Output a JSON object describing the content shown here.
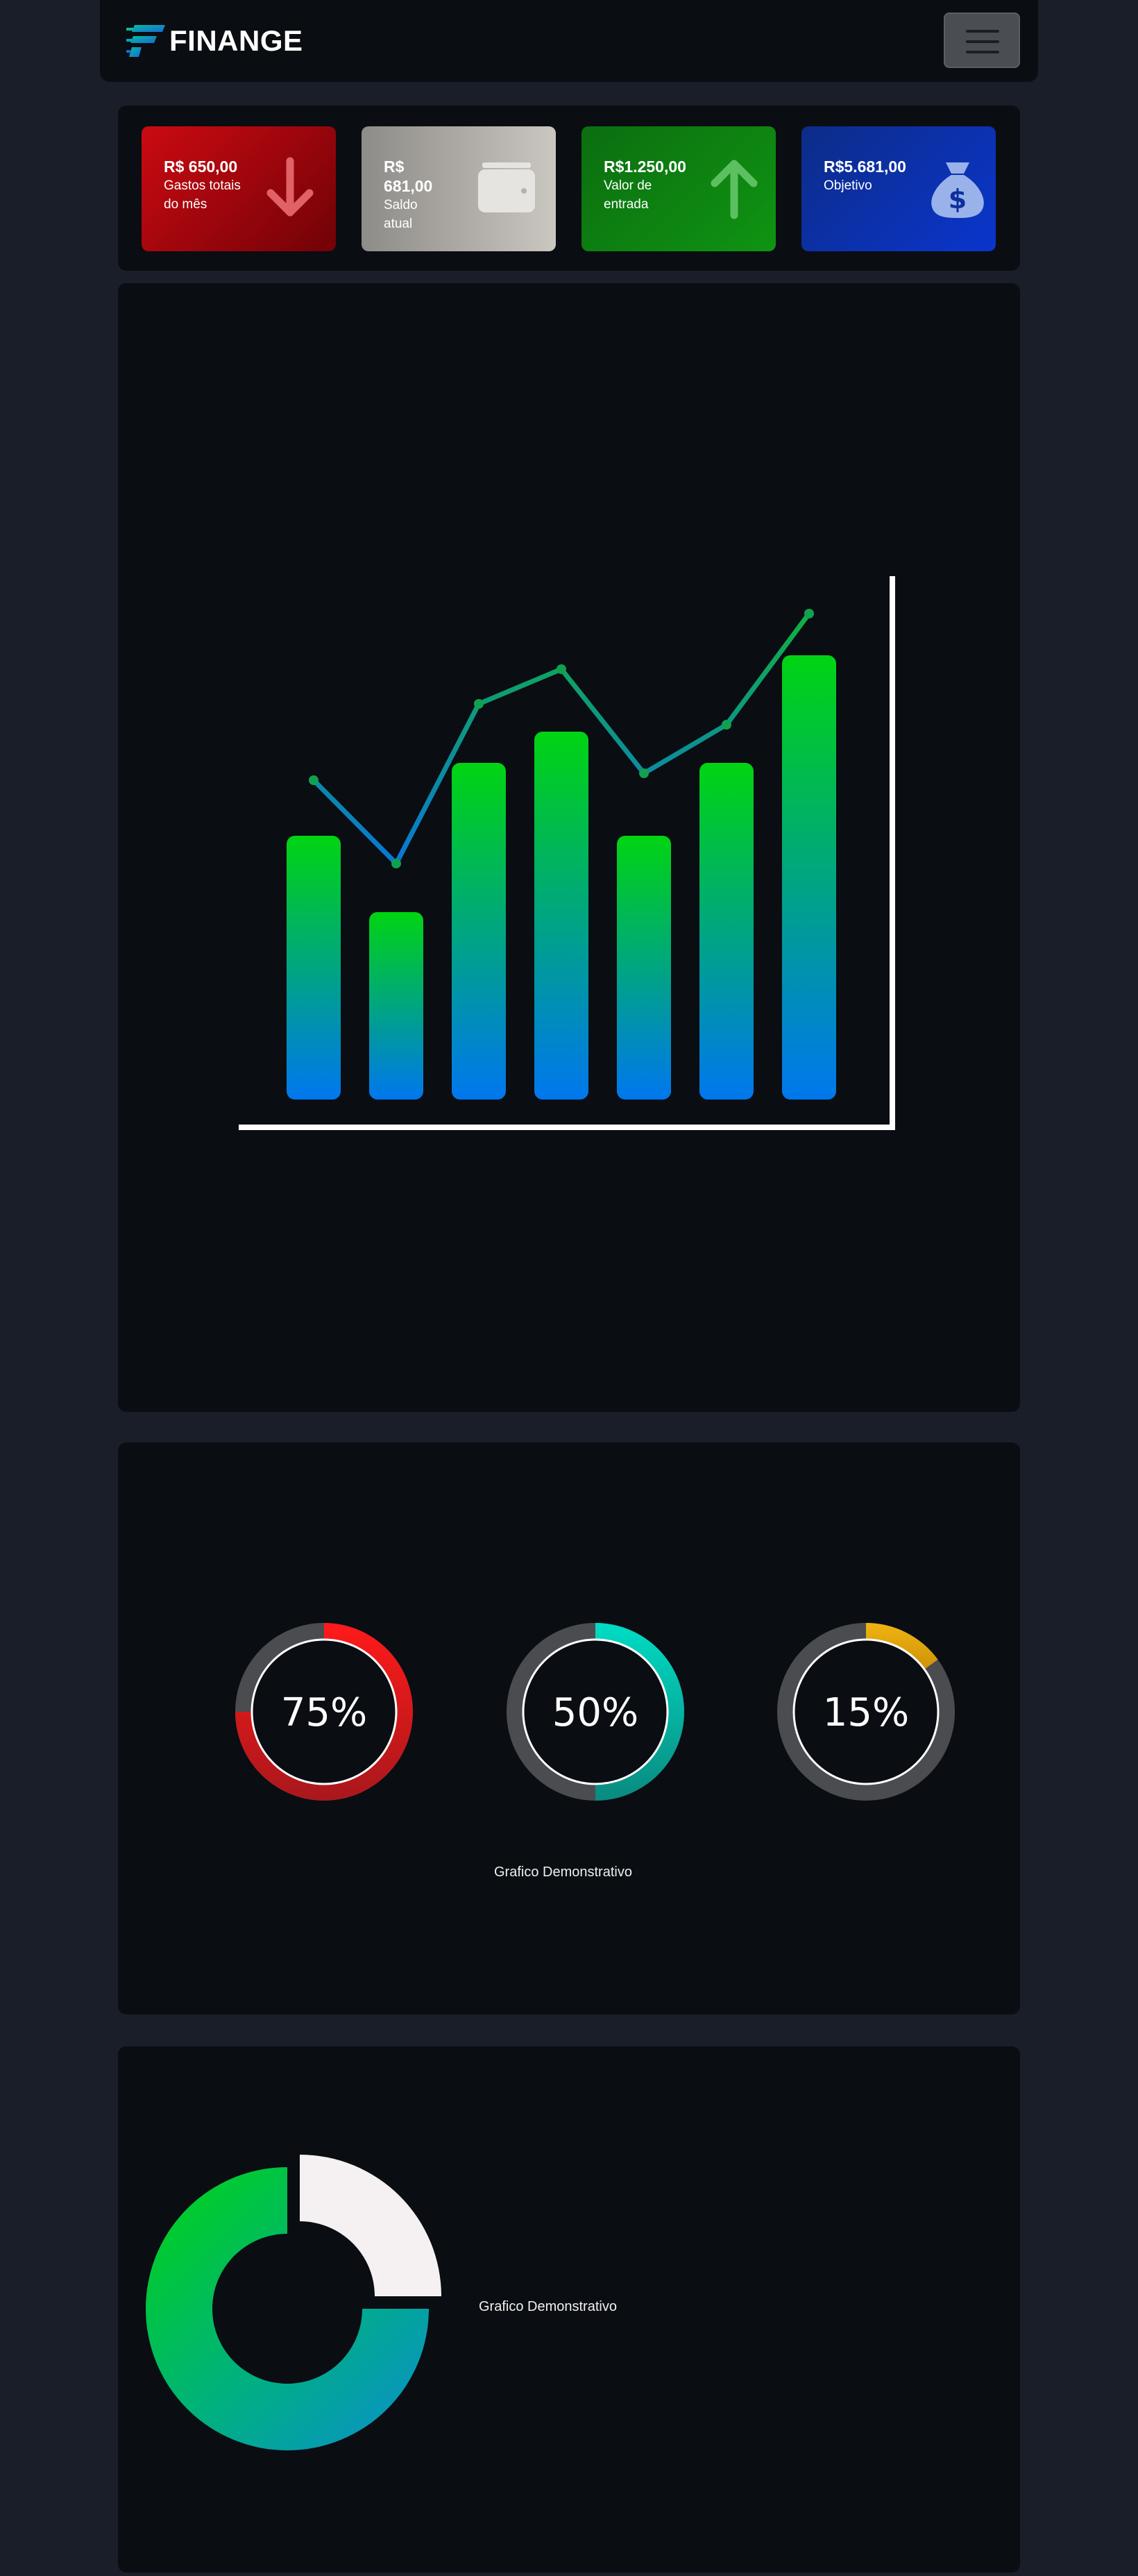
{
  "navbar": {
    "logo_text": "FINANGE",
    "menu_icon": "hamburger-menu-icon"
  },
  "cards": [
    {
      "value": "R$ 650,00",
      "label_lines": [
        "Gastos totais",
        "do mês"
      ],
      "icon": "arrow-down-icon"
    },
    {
      "value_lines": [
        "R$",
        "681,00"
      ],
      "label_lines": [
        "Saldo",
        "atual"
      ],
      "icon": "wallet-icon"
    },
    {
      "value": "R$1.250,00",
      "label_lines": [
        "Valor de",
        "entrada"
      ],
      "icon": "arrow-up-icon"
    },
    {
      "value": "R$5.681,00",
      "label_lines": [
        "Objetivo"
      ],
      "icon": "money-bag-icon"
    }
  ],
  "colors": {
    "background": "#1a1e29",
    "panel": "#0a0d12",
    "green": "#00d412",
    "blue": "#0077ee",
    "red": "#ee1111",
    "teal": "#00d8c0",
    "gold": "#e6ac10",
    "grey": "#4a4c50"
  },
  "chart_data": [
    {
      "type": "bar",
      "title": "",
      "xlabel": "",
      "ylabel": "",
      "ylim": [
        0,
        10
      ],
      "grid": false,
      "series": [
        {
          "type": "bar",
          "values": [
            3.8,
            2.7,
            4.85,
            5.3,
            3.8,
            4.85,
            6.4
          ]
        },
        {
          "type": "line",
          "values": [
            4.6,
            3.4,
            5.7,
            6.2,
            4.7,
            5.4,
            7.0
          ]
        }
      ]
    },
    {
      "type": "pie",
      "subtype": "progress-donuts",
      "values": [
        75,
        50,
        15
      ],
      "labels": [
        "75%",
        "50%",
        "15%"
      ],
      "caption": "Grafico Demonstrativo"
    },
    {
      "type": "pie",
      "subtype": "donut",
      "values": [
        25,
        75
      ],
      "caption": "Grafico Demonstrativo"
    }
  ]
}
